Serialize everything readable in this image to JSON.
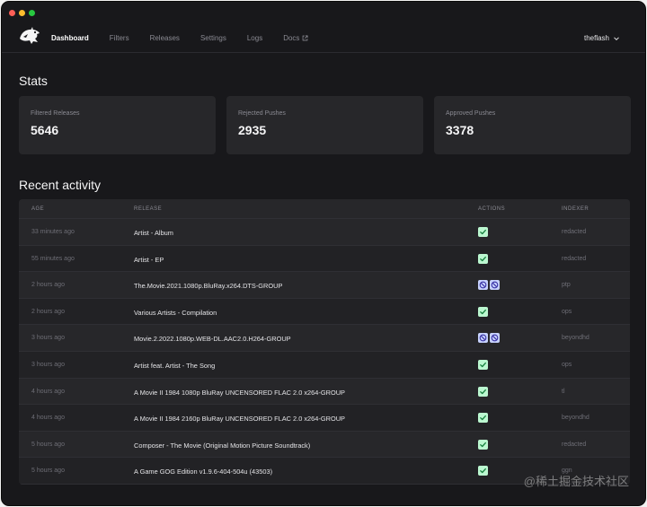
{
  "nav": {
    "items": [
      {
        "label": "Dashboard",
        "active": true
      },
      {
        "label": "Filters",
        "active": false
      },
      {
        "label": "Releases",
        "active": false
      },
      {
        "label": "Settings",
        "active": false
      },
      {
        "label": "Logs",
        "active": false
      },
      {
        "label": "Docs",
        "active": false,
        "external": true
      }
    ],
    "user": "theflash"
  },
  "stats": {
    "title": "Stats",
    "cards": [
      {
        "label": "Filtered Releases",
        "value": "5646"
      },
      {
        "label": "Rejected Pushes",
        "value": "2935"
      },
      {
        "label": "Approved Pushes",
        "value": "3378"
      }
    ]
  },
  "activity": {
    "title": "Recent activity",
    "columns": [
      "AGE",
      "RELEASE",
      "ACTIONS",
      "INDEXER"
    ],
    "rows": [
      {
        "age": "33 minutes ago",
        "release": "Artist - Album",
        "actions": [
          "approved"
        ],
        "indexer": "redacted"
      },
      {
        "age": "55 minutes ago",
        "release": "Artist - EP",
        "actions": [
          "approved"
        ],
        "indexer": "redacted"
      },
      {
        "age": "2 hours ago",
        "release": "The.Movie.2021.1080p.BluRay.x264.DTS-GROUP",
        "actions": [
          "rejected",
          "rejected"
        ],
        "indexer": "ptp"
      },
      {
        "age": "2 hours ago",
        "release": "Various Artists - Compilation",
        "actions": [
          "approved"
        ],
        "indexer": "ops"
      },
      {
        "age": "3 hours ago",
        "release": "Movie.2.2022.1080p.WEB-DL.AAC2.0.H264-GROUP",
        "actions": [
          "rejected",
          "rejected"
        ],
        "indexer": "beyondhd"
      },
      {
        "age": "3 hours ago",
        "release": "Artist feat. Artist - The Song",
        "actions": [
          "approved"
        ],
        "indexer": "ops"
      },
      {
        "age": "4 hours ago",
        "release": "A Movie II 1984 1080p BluRay UNCENSORED FLAC 2.0 x264-GROUP",
        "actions": [
          "approved"
        ],
        "indexer": "tl"
      },
      {
        "age": "4 hours ago",
        "release": "A Movie II 1984 2160p BluRay UNCENSORED FLAC 2.0 x264-GROUP",
        "actions": [
          "approved"
        ],
        "indexer": "beyondhd"
      },
      {
        "age": "5 hours ago",
        "release": "Composer - The Movie (Original Motion Picture Soundtrack)",
        "actions": [
          "approved"
        ],
        "indexer": "redacted"
      },
      {
        "age": "5 hours ago",
        "release": "A Game GOG Edition v1.9.6-404-504u (43503)",
        "actions": [
          "approved"
        ],
        "indexer": "ggn"
      }
    ]
  },
  "watermark": "@稀土掘金技术社区",
  "colors": {
    "background": "#18181b",
    "card": "#27272a",
    "approved": "#bbf7d0",
    "rejected": "#c7d2fe"
  }
}
